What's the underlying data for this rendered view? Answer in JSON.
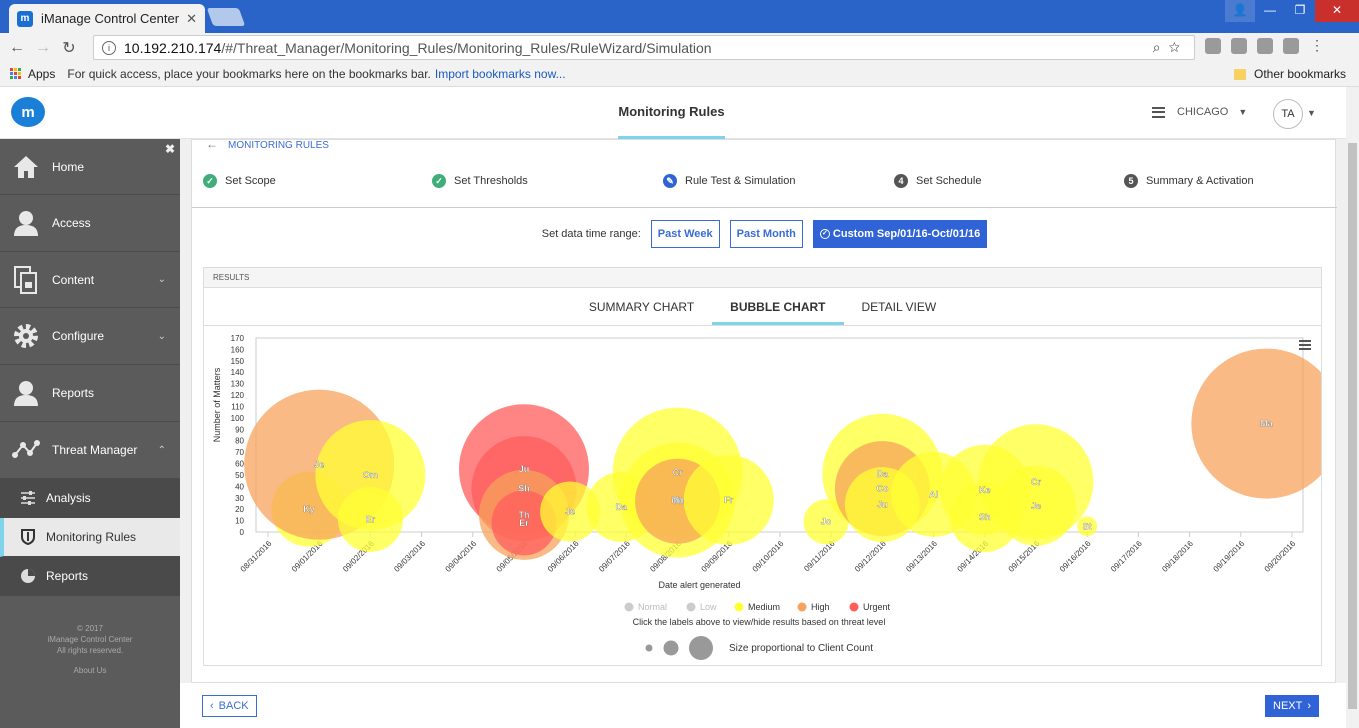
{
  "browser": {
    "tab_title": "iManage Control Center",
    "tab_favicon": "m",
    "url_host": "10.192.210.174",
    "url_path": "/#/Threat_Manager/Monitoring_Rules/Monitoring_Rules/RuleWizard/Simulation",
    "bookmarks_apps": "Apps",
    "bookmarks_hint": "For quick access, place your bookmarks here on the bookmarks bar.",
    "bookmarks_import": "Import bookmarks now...",
    "bookmarks_other": "Other bookmarks"
  },
  "header": {
    "logo": "m",
    "title": "Monitoring Rules",
    "location": "CHICAGO",
    "avatar": "TA"
  },
  "sidebar": {
    "items": [
      {
        "label": "Home",
        "icon": "home-icon"
      },
      {
        "label": "Access",
        "icon": "user-icon"
      },
      {
        "label": "Content",
        "icon": "documents-icon"
      },
      {
        "label": "Configure",
        "icon": "gear-icon"
      },
      {
        "label": "Reports",
        "icon": "user-icon"
      },
      {
        "label": "Threat Manager",
        "icon": "network-icon"
      }
    ],
    "sub_items": [
      {
        "label": "Analysis",
        "icon": "sliders-icon"
      },
      {
        "label": "Monitoring Rules",
        "icon": "shield-icon"
      },
      {
        "label": "Reports",
        "icon": "pie-icon"
      }
    ],
    "footer": {
      "copyright": "© 2017",
      "product": "iManage Control Center",
      "rights": "All rights reserved.",
      "about": "About Us"
    }
  },
  "wizard": {
    "breadcrumb": "MONITORING RULES",
    "steps": [
      {
        "label": "Set Scope",
        "state": "done"
      },
      {
        "label": "Set Thresholds",
        "state": "done"
      },
      {
        "label": "Rule Test & Simulation",
        "state": "active"
      },
      {
        "label": "Set Schedule",
        "state": "pending",
        "num": "4"
      },
      {
        "label": "Summary & Activation",
        "state": "pending",
        "num": "5"
      }
    ],
    "range_label": "Set data time range:",
    "range_buttons": [
      "Past Week",
      "Past Month",
      "Custom Sep/01/16-Oct/01/16"
    ],
    "results_title": "RESULTS",
    "result_tabs": [
      "SUMMARY CHART",
      "BUBBLE CHART",
      "DETAIL VIEW"
    ],
    "back": "BACK",
    "next": "NEXT"
  },
  "colors": {
    "accent": "#2f63d6",
    "medium": "#ffff33",
    "high": "#f7a35c",
    "urgent": "#ff5c5c",
    "normal": "#cccccc",
    "low": "#cccccc"
  },
  "chart_data": {
    "type": "scatter",
    "variant": "bubble",
    "xlabel": "Date alert generated",
    "ylabel": "Number of Matters",
    "ylim": [
      0,
      170
    ],
    "yticks": [
      0,
      10,
      20,
      30,
      40,
      50,
      60,
      70,
      80,
      90,
      100,
      110,
      120,
      130,
      140,
      150,
      160,
      170
    ],
    "xticks": [
      "08/31/2016",
      "09/01/2016",
      "09/02/2016",
      "09/03/2016",
      "09/04/2016",
      "09/05/2016",
      "09/06/2016",
      "09/07/2016",
      "09/08/2016",
      "09/09/2016",
      "09/10/2016",
      "09/11/2016",
      "09/12/2016",
      "09/13/2016",
      "09/14/2016",
      "09/15/2016",
      "09/16/2016",
      "09/17/2016",
      "09/18/2016",
      "09/19/2016",
      "09/20/2016"
    ],
    "legend": [
      {
        "name": "Normal",
        "level": "normal"
      },
      {
        "name": "Low",
        "level": "low"
      },
      {
        "name": "Medium",
        "level": "medium"
      },
      {
        "name": "High",
        "level": "high"
      },
      {
        "name": "Urgent",
        "level": "urgent"
      }
    ],
    "legend_hint": "Click the labels above to view/hide results based on threat level",
    "size_note": "Size proportional to Client Count",
    "points": [
      {
        "date": "09/01/2016",
        "day": 0.8,
        "y": 20,
        "size": 30,
        "level": "medium",
        "label": "Ky"
      },
      {
        "date": "09/01/2016",
        "day": 1.0,
        "y": 59,
        "size": 60,
        "level": "high",
        "label": "Je"
      },
      {
        "date": "09/02/2016",
        "day": 2.0,
        "y": 50,
        "size": 44,
        "level": "medium",
        "label": "Om"
      },
      {
        "date": "09/02/2016",
        "day": 2.0,
        "y": 11,
        "size": 26,
        "level": "medium",
        "label": "Er"
      },
      {
        "date": "09/05/2016",
        "day": 5.0,
        "y": 55,
        "size": 52,
        "level": "urgent",
        "label": "Ju"
      },
      {
        "date": "09/05/2016",
        "day": 5.0,
        "y": 38,
        "size": 42,
        "level": "urgent",
        "label": "Sh"
      },
      {
        "date": "09/05/2016",
        "day": 5.0,
        "y": 15,
        "size": 36,
        "level": "high",
        "label": "Th"
      },
      {
        "date": "09/05/2016",
        "day": 5.0,
        "y": 8,
        "size": 26,
        "level": "urgent",
        "label": "Er"
      },
      {
        "date": "09/06/2016",
        "day": 5.9,
        "y": 18,
        "size": 24,
        "level": "medium",
        "label": "Je"
      },
      {
        "date": "09/07/2016",
        "day": 6.9,
        "y": 22,
        "size": 28,
        "level": "medium",
        "label": "Da"
      },
      {
        "date": "09/08/2016",
        "day": 8.0,
        "y": 52,
        "size": 52,
        "level": "medium",
        "label": "Cr"
      },
      {
        "date": "09/08/2016",
        "day": 8.0,
        "y": 28,
        "size": 46,
        "level": "medium",
        "label": "Ma"
      },
      {
        "date": "09/08/2016",
        "day": 8.0,
        "y": 27,
        "size": 34,
        "level": "high",
        "label": "Th"
      },
      {
        "date": "09/09/2016",
        "day": 9.0,
        "y": 28,
        "size": 36,
        "level": "medium",
        "label": "Fr"
      },
      {
        "date": "09/11/2016",
        "day": 10.9,
        "y": 9,
        "size": 18,
        "level": "medium",
        "label": "Jo"
      },
      {
        "date": "09/12/2016",
        "day": 12.0,
        "y": 51,
        "size": 48,
        "level": "medium",
        "label": "Da"
      },
      {
        "date": "09/12/2016",
        "day": 12.0,
        "y": 38,
        "size": 38,
        "level": "high",
        "label": "Co"
      },
      {
        "date": "09/12/2016",
        "day": 12.0,
        "y": 24,
        "size": 30,
        "level": "medium",
        "label": "Ju"
      },
      {
        "date": "09/13/2016",
        "day": 13.0,
        "y": 33,
        "size": 34,
        "level": "medium",
        "label": "Al"
      },
      {
        "date": "09/14/2016",
        "day": 14.0,
        "y": 37,
        "size": 36,
        "level": "medium",
        "label": "Ke"
      },
      {
        "date": "09/14/2016",
        "day": 14.0,
        "y": 13,
        "size": 28,
        "level": "medium",
        "label": "Sh"
      },
      {
        "date": "09/15/2016",
        "day": 15.0,
        "y": 44,
        "size": 46,
        "level": "medium",
        "label": "Cr"
      },
      {
        "date": "09/15/2016",
        "day": 15.0,
        "y": 23,
        "size": 32,
        "level": "medium",
        "label": "Je"
      },
      {
        "date": "09/16/2016",
        "day": 16.0,
        "y": 5,
        "size": 8,
        "level": "medium",
        "label": "St"
      },
      {
        "date": "09/20/2016",
        "day": 19.5,
        "y": 95,
        "size": 60,
        "level": "high",
        "label": "Ma"
      }
    ]
  }
}
